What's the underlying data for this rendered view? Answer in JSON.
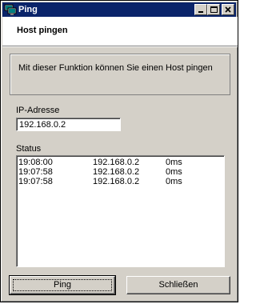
{
  "window": {
    "title": "Ping",
    "icon": "network-icon"
  },
  "header": {
    "title": "Host pingen"
  },
  "description": "Mit dieser Funktion können Sie einen Host pingen",
  "ip": {
    "label": "IP-Adresse",
    "value": "192.168.0.2"
  },
  "status": {
    "label": "Status",
    "rows": [
      {
        "time": "19:08:00",
        "ip": "192.168.0.2",
        "ms": "0ms"
      },
      {
        "time": "19:07:58",
        "ip": "192.168.0.2",
        "ms": "0ms"
      },
      {
        "time": "19:07:58",
        "ip": "192.168.0.2",
        "ms": "0ms"
      }
    ]
  },
  "buttons": {
    "ping": "Ping",
    "close": "Schließen"
  },
  "colors": {
    "titlebar": "#0a246a",
    "face": "#d4d0c8"
  }
}
